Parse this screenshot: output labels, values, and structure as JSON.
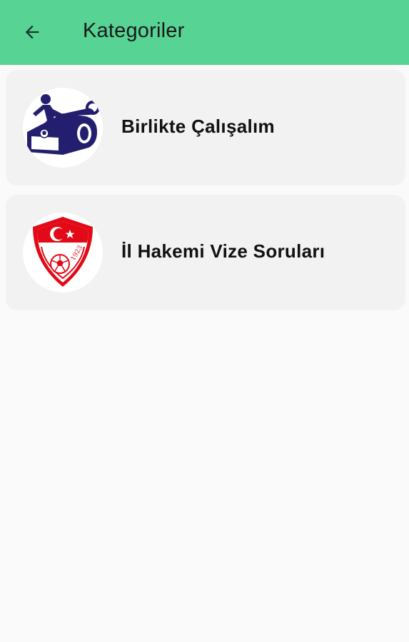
{
  "appbar": {
    "title": "Kategoriler",
    "back_icon": "arrow-left-icon",
    "color": "#57d394"
  },
  "categories": [
    {
      "label": "Birlikte Çalışalım",
      "icon": "referee-whistle-logo"
    },
    {
      "label": "İl Hakemi Vize Soruları",
      "icon": "tff-crest-logo",
      "crest_year": "1923"
    }
  ],
  "colors": {
    "background": "#fafafa",
    "card": "#f2f2f2",
    "logo_navy": "#231f6e",
    "crest_red": "#e30a17"
  }
}
